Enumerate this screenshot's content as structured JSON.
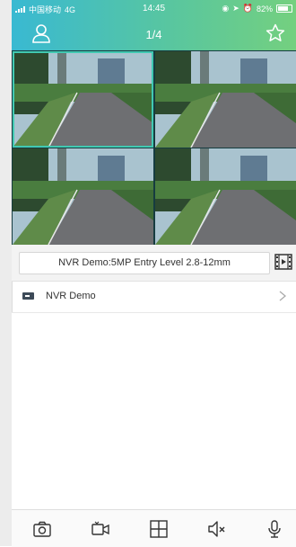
{
  "status_bar": {
    "carrier": "中国移动",
    "network": "4G",
    "time": "14:45",
    "battery": "82%"
  },
  "header": {
    "title": "1/4",
    "left_icon": "user-icon",
    "right_icon": "star-icon"
  },
  "video_grid": {
    "tiles": 4,
    "active_tile": 1
  },
  "device_label": {
    "text": "NVR Demo:5MP Entry Level 2.8-12mm",
    "icon": "film-icon"
  },
  "device_list": [
    {
      "name": "NVR Demo",
      "icon": "nvr-icon"
    }
  ],
  "toolbar": {
    "buttons": [
      "camera-snapshot-icon",
      "video-record-icon",
      "grid-layout-icon",
      "mute-icon",
      "microphone-icon"
    ]
  },
  "colors": {
    "header_start": "#39b9d2",
    "header_end": "#74d07f",
    "accent": "#41c9b2"
  }
}
